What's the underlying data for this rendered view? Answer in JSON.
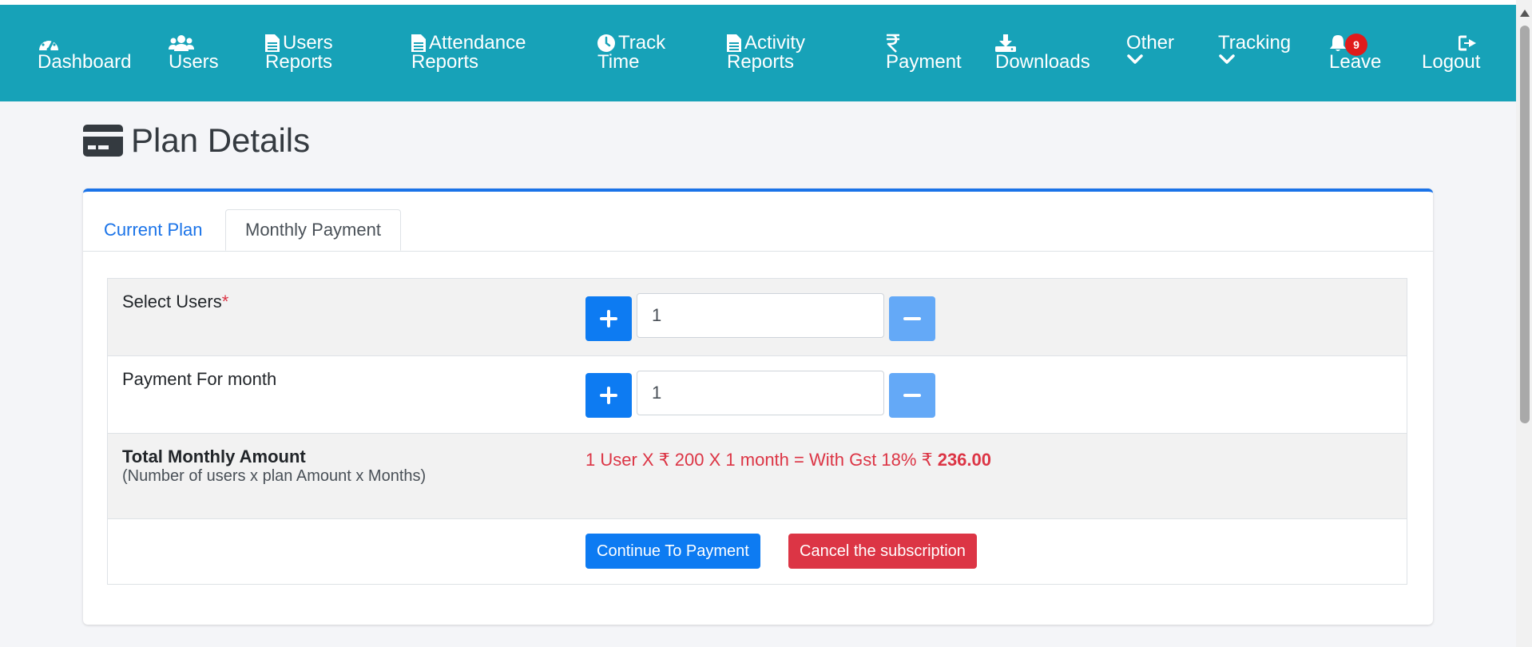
{
  "navbar": {
    "items": [
      {
        "icon": "dashboard-icon",
        "line1": "",
        "line2": "Dashboard"
      },
      {
        "icon": "users-icon",
        "line1": "",
        "line2": "Users"
      },
      {
        "icon": "document-icon",
        "line1": "Users",
        "line2": "Reports"
      },
      {
        "icon": "document-icon",
        "line1": "Attendance",
        "line2": "Reports"
      },
      {
        "icon": "clock-icon",
        "line1": "Track",
        "line2": "Time"
      },
      {
        "icon": "document-icon",
        "line1": "Activity",
        "line2": "Reports"
      },
      {
        "icon": "rupee-icon",
        "line1": "",
        "line2": "Payment"
      },
      {
        "icon": "download-icon",
        "line1": "",
        "line2": "Downloads"
      },
      {
        "icon": "chevron-down-icon",
        "line1": "Other",
        "line2": ""
      },
      {
        "icon": "chevron-down-icon",
        "line1": "Tracking",
        "line2": ""
      },
      {
        "icon": "bell-icon",
        "line1": "",
        "line2": "Leave"
      },
      {
        "icon": "logout-icon",
        "line1": "",
        "line2": "Logout"
      }
    ],
    "leave_badge": "9",
    "colors": {
      "bar": "#17a2b8",
      "highlight": "#e0262d"
    }
  },
  "page": {
    "title": "Plan Details",
    "title_icon": "credit-card-icon"
  },
  "tabs": {
    "current_plan": "Current Plan",
    "monthly_payment": "Monthly Payment"
  },
  "form": {
    "select_users_label": "Select Users",
    "required_mark": "*",
    "users_value": "1",
    "months_label": "Payment For month",
    "months_value": "1",
    "total_label": "Total Monthly Amount",
    "total_sublabel": "(Number of users x plan Amount x Months)",
    "formula_text": "1 User X ₹ 200 X 1 month = With Gst 18% ₹",
    "total_amount": "236.00",
    "continue_button": "Continue To Payment",
    "cancel_button": "Cancel the subscription"
  }
}
